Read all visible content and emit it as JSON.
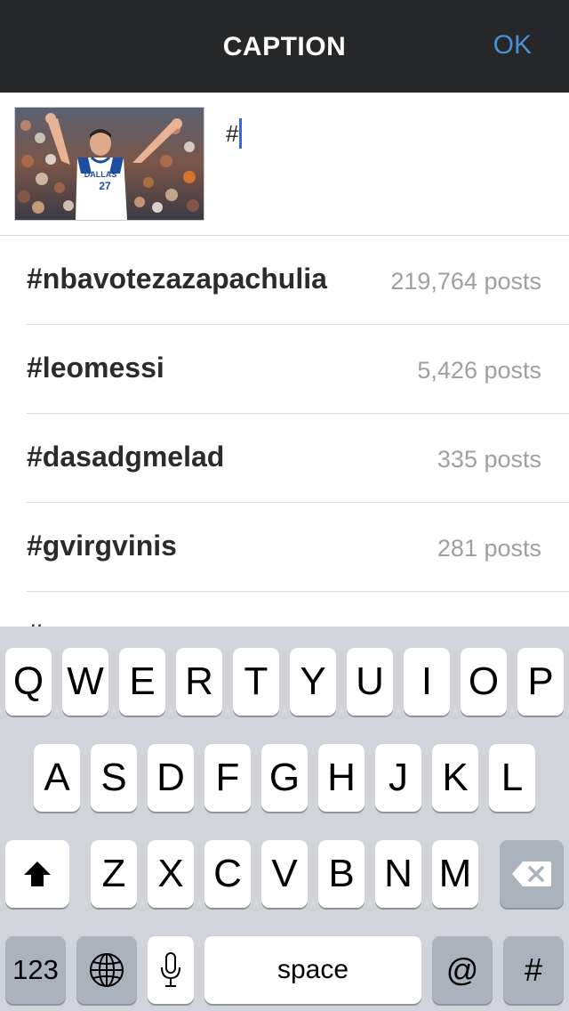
{
  "navbar": {
    "title": "CAPTION",
    "ok_label": "OK"
  },
  "composer": {
    "caption_text": "#",
    "thumbnail": {
      "jersey_text": "DALLAS",
      "jersey_number": "27",
      "colors": {
        "jersey": "#ffffff",
        "trim": "#1e4ea1",
        "skin": "#e7b394",
        "crowd": "#8a4f3e"
      }
    }
  },
  "suggestions": [
    {
      "tag": "#nbavotezazapachulia",
      "count": "219,764 posts"
    },
    {
      "tag": "#leomessi",
      "count": "5,426 posts"
    },
    {
      "tag": "#dasadgmelad",
      "count": "335 posts"
    },
    {
      "tag": "#gvirgvinis",
      "count": "281 posts"
    },
    {
      "tag": "#",
      "count": ""
    }
  ],
  "keyboard": {
    "row1": [
      "Q",
      "W",
      "E",
      "R",
      "T",
      "Y",
      "U",
      "I",
      "O",
      "P"
    ],
    "row2": [
      "A",
      "S",
      "D",
      "F",
      "G",
      "H",
      "J",
      "K",
      "L"
    ],
    "row3": [
      "Z",
      "X",
      "C",
      "V",
      "B",
      "N",
      "M"
    ],
    "numbers_label": "123",
    "space_label": "space",
    "at_label": "@",
    "hash_label": "#",
    "icons": {
      "shift": "shift-icon",
      "delete": "delete-icon",
      "globe": "globe-icon",
      "mic": "microphone-icon"
    }
  },
  "colors": {
    "navbar_bg": "#262729",
    "accent": "#4a90d6",
    "cursor": "#3a66e0",
    "keyboard_bg": "#d1d5db",
    "dark_key": "#abb2bc"
  }
}
